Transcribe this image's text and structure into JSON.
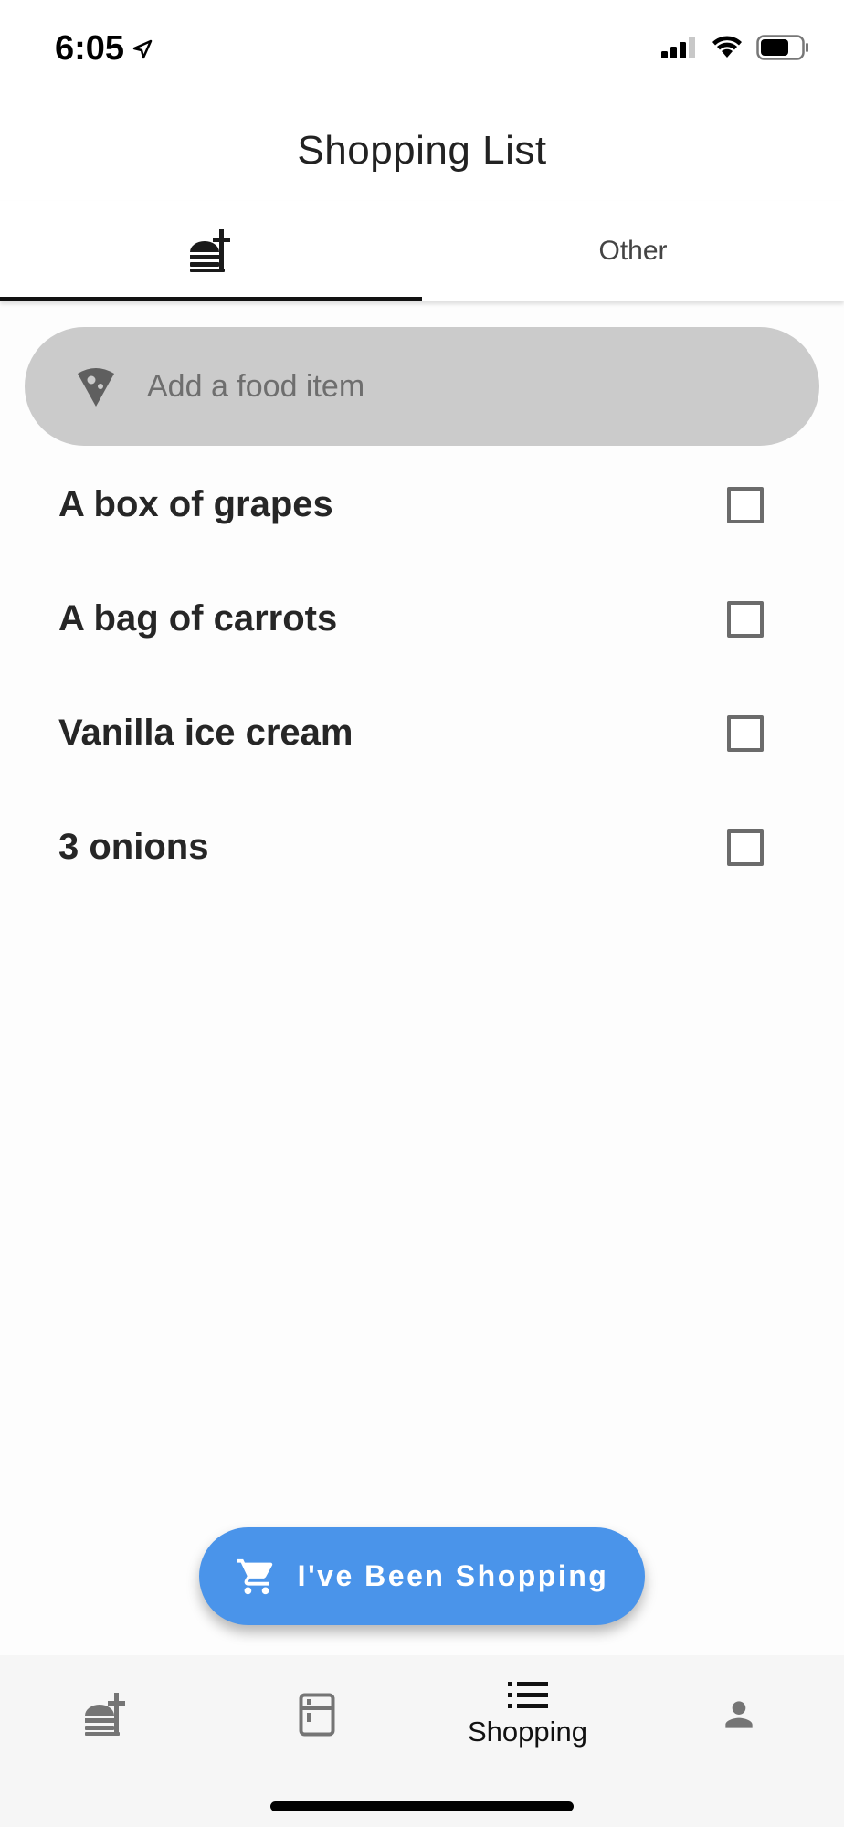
{
  "status_bar": {
    "time": "6:05",
    "icons": [
      "location-arrow-icon",
      "cellular-signal-icon",
      "wifi-icon",
      "battery-icon"
    ]
  },
  "header": {
    "title": "Shopping List"
  },
  "tabs": [
    {
      "icon": "fast-food-icon",
      "label": "",
      "selected": true
    },
    {
      "icon": "",
      "label": "Other",
      "selected": false
    }
  ],
  "search": {
    "placeholder": "Add a food item",
    "icon": "pizza-icon"
  },
  "items": [
    {
      "label": "A box of grapes",
      "checked": false
    },
    {
      "label": "A bag of carrots",
      "checked": false
    },
    {
      "label": "Vanilla ice cream",
      "checked": false
    },
    {
      "label": "3 onions",
      "checked": false
    }
  ],
  "fab": {
    "label": "I've Been Shopping",
    "icon": "shopping-cart-icon",
    "color": "#4a94ea"
  },
  "bottom_nav": [
    {
      "icon": "fast-food-icon",
      "label": "",
      "selected": false
    },
    {
      "icon": "fridge-icon",
      "label": "",
      "selected": false
    },
    {
      "icon": "list-icon",
      "label": "Shopping",
      "selected": true
    },
    {
      "icon": "person-icon",
      "label": "",
      "selected": false
    }
  ]
}
